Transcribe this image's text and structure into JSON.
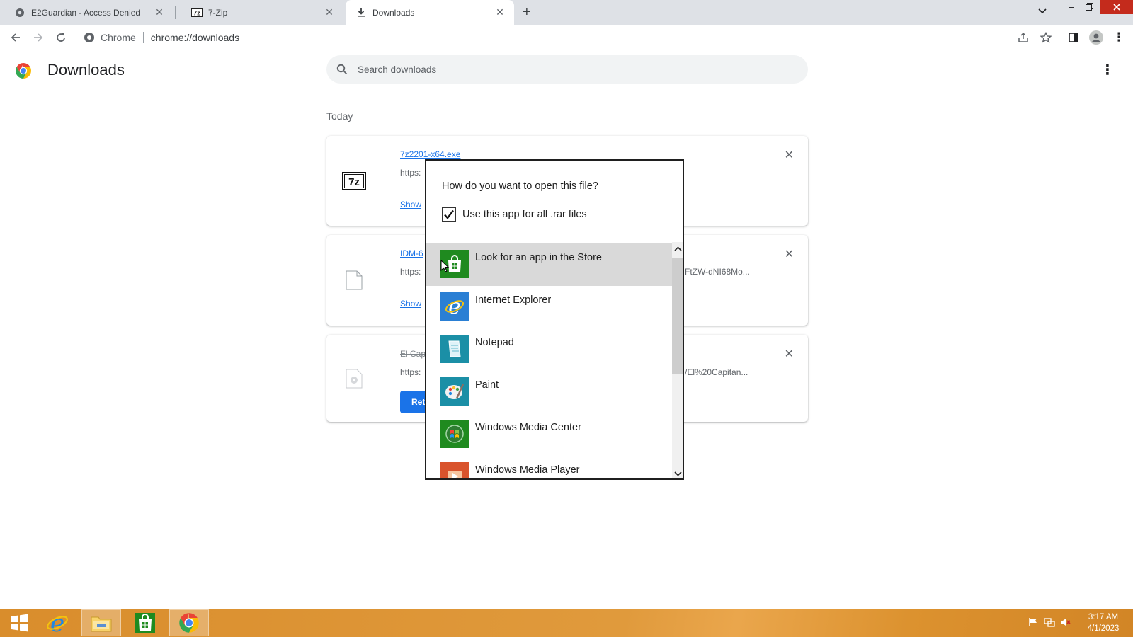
{
  "browser": {
    "tabs": [
      {
        "title": "E2Guardian - Access Denied",
        "icon": "globe-icon"
      },
      {
        "title": "7-Zip",
        "icon": "7zip-favicon"
      },
      {
        "title": "Downloads",
        "icon": "download-icon",
        "active": true
      }
    ],
    "new_tab_label": "+",
    "omnibox": {
      "site_chip": "Chrome",
      "url": "chrome://downloads"
    }
  },
  "page": {
    "title": "Downloads",
    "search_placeholder": "Search downloads",
    "section_today": "Today"
  },
  "downloads": [
    {
      "filename": "7z2201-x64.exe",
      "url_prefix": "https:",
      "url_tail": "",
      "action": "Show",
      "icon": "7z-file-icon"
    },
    {
      "filename": "IDM-6",
      "url_prefix": "https:",
      "url_tail": "FtZW-dNI68Mo...",
      "action": "Show",
      "icon": "blank-file-icon"
    },
    {
      "filename": "El Cap",
      "url_prefix": "https:",
      "url_tail": "/El%20Capitan...",
      "action": "Ret",
      "icon": "disk-image-icon",
      "cancelled": true
    }
  ],
  "dialog": {
    "question": "How do you want to open this file?",
    "checkbox_label": "Use this app for all .rar files",
    "checkbox_checked": true,
    "apps": [
      {
        "label": "Look for an app in the Store",
        "icon": "store-icon",
        "highlighted": true
      },
      {
        "label": "Internet Explorer",
        "icon": "internet-explorer-icon"
      },
      {
        "label": "Notepad",
        "icon": "notepad-icon"
      },
      {
        "label": "Paint",
        "icon": "paint-icon"
      },
      {
        "label": "Windows Media Center",
        "icon": "media-center-icon"
      },
      {
        "label": "Windows Media Player",
        "icon": "media-player-icon"
      }
    ]
  },
  "taskbar": {
    "time": "3:17 AM",
    "date": "4/1/2023",
    "pinned": [
      "start-button",
      "internet-explorer",
      "file-explorer",
      "store",
      "chrome"
    ]
  },
  "colors": {
    "accent": "#1a73e8",
    "taskbar": "#e09a3c",
    "highlight": "#d9d9d9"
  }
}
